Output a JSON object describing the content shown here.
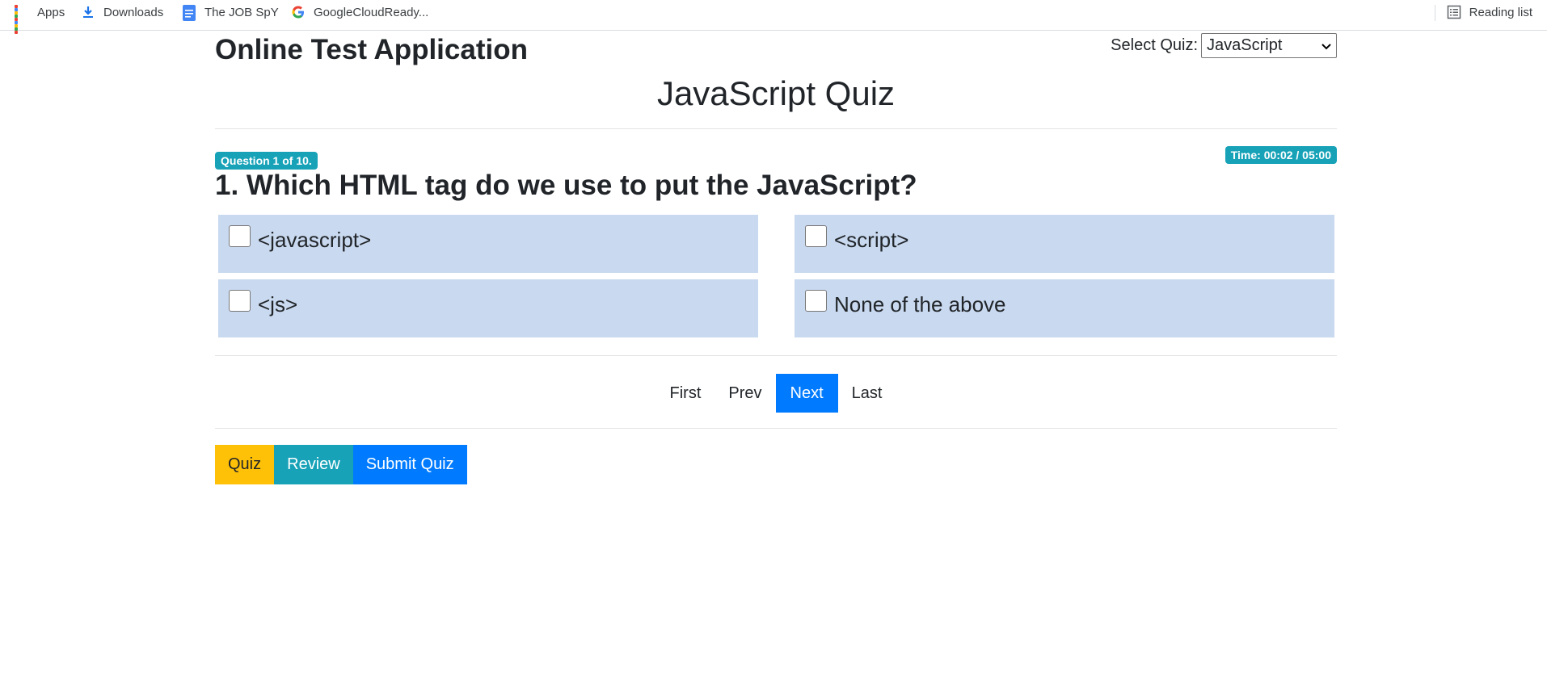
{
  "bookmarks": {
    "apps": "Apps",
    "downloads": "Downloads",
    "jobspy": "The JOB SpY",
    "gcr": "GoogleCloudReady...",
    "reading_list": "Reading list"
  },
  "header": {
    "app_title": "Online Test Application",
    "select_label": "Select Quiz:",
    "select_value": "JavaScript"
  },
  "quiz": {
    "title": "JavaScript Quiz",
    "question_badge": "Question 1 of 10.",
    "time_badge": "Time: 00:02 / 05:00",
    "question_text": "1. Which HTML tag do we use to put the JavaScript?",
    "options": [
      {
        "label": "<javascript>",
        "checked": false
      },
      {
        "label": "<script>",
        "checked": false
      },
      {
        "label": "<js>",
        "checked": false
      },
      {
        "label": "None of the above",
        "checked": false
      }
    ]
  },
  "pager": {
    "first": "First",
    "prev": "Prev",
    "next": "Next",
    "last": "Last"
  },
  "actions": {
    "quiz": "Quiz",
    "review": "Review",
    "submit": "Submit Quiz"
  },
  "colors": {
    "primary": "#007bff",
    "info": "#17a2b8",
    "warning": "#ffc107",
    "option_bg": "#c9d9ef"
  }
}
